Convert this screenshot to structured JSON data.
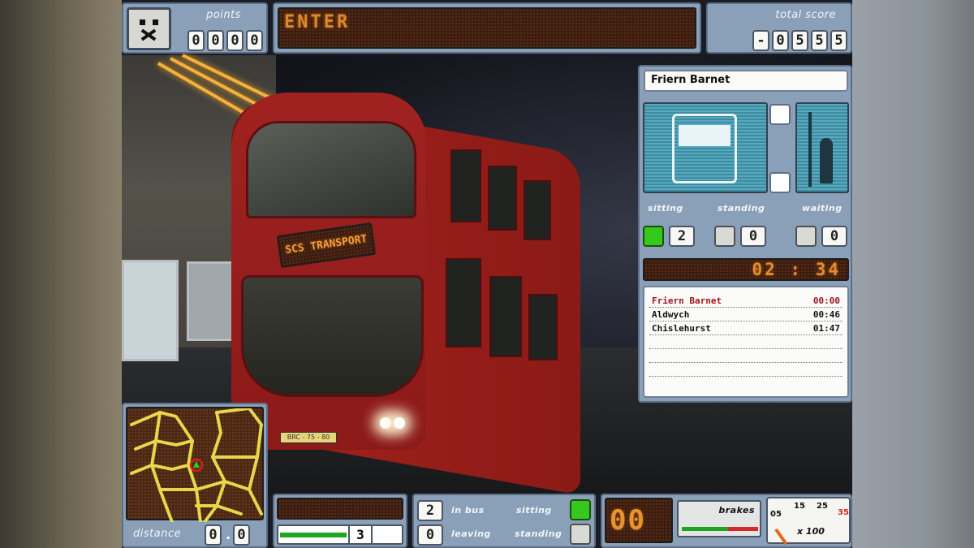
{
  "hud": {
    "points_label": "points",
    "points_digits": [
      "0",
      "0",
      "0",
      "0"
    ],
    "message": "ENTER",
    "total_score_label": "total score",
    "total_score_digits": [
      "-",
      "0",
      "5",
      "5",
      "5"
    ]
  },
  "bus": {
    "destination": "SCS TRANSPORT",
    "plate": "BRC - 75 - 80"
  },
  "stop_panel": {
    "current_stop": "Friern Barnet",
    "sitting_label": "sitting",
    "standing_label": "standing",
    "waiting_label": "waiting",
    "sitting_count": "2",
    "standing_count": "0",
    "waiting_count": "0",
    "timer": "02 : 34",
    "schedule": [
      {
        "stop": "Friern Barnet",
        "time": "00:00",
        "current": true
      },
      {
        "stop": "Aldwych",
        "time": "00:46",
        "current": false
      },
      {
        "stop": "Chislehurst",
        "time": "01:47",
        "current": false
      },
      {
        "stop": "",
        "time": "",
        "current": false
      },
      {
        "stop": "",
        "time": "",
        "current": false
      },
      {
        "stop": "",
        "time": "",
        "current": false
      }
    ]
  },
  "bottom": {
    "distance_label": "distance",
    "distance_digits": [
      "0",
      ".",
      "0",
      "0"
    ],
    "gear": "3",
    "in_bus_count": "2",
    "in_bus_label": "in bus",
    "leaving_count": "0",
    "leaving_label": "leaving",
    "sitting_label": "sitting",
    "standing_label": "standing",
    "speed_digits": "00",
    "brakes_label": "brakes",
    "gauge_ticks": [
      "05",
      "15",
      "25",
      "35"
    ],
    "gauge_unit": "x 100"
  },
  "colors": {
    "panel": "#8aa0b8",
    "led_text": "#d98a2a",
    "happy_face": "#34c91c",
    "current_stop_red": "#a3131b"
  }
}
